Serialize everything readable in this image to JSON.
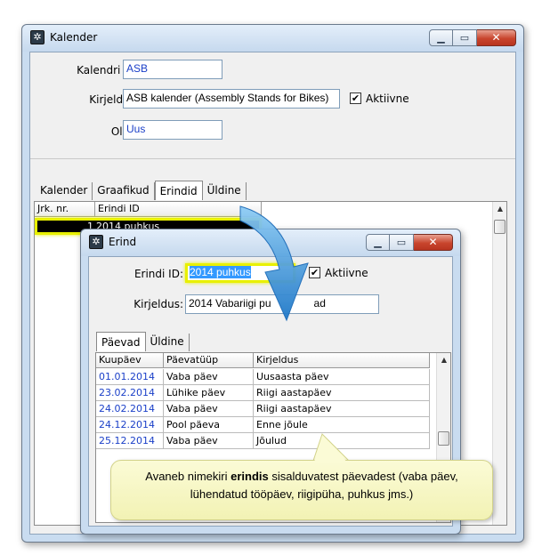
{
  "kalender_window": {
    "title": "Kalender",
    "fields": {
      "id_label": "Kalendri ID:",
      "id_value": "ASB",
      "desc_label": "Kirjeldus:",
      "desc_value": "ASB kalender (Assembly Stands for Bikes)",
      "active_label": "Aktiivne",
      "active_checked": "✔",
      "status_label": "Olek:",
      "status_value": "Uus"
    },
    "tabs": [
      "Kalender",
      "Graafikud",
      "Erindid",
      "Üldine"
    ],
    "table": {
      "headers": [
        "Jrk. nr.",
        "Erindi ID"
      ],
      "rows": [
        {
          "nr": "1",
          "id": "2014 puhkus"
        }
      ]
    }
  },
  "erind_window": {
    "title": "Erind",
    "fields": {
      "id_label": "Erindi ID:",
      "id_value": "2014 puhkus",
      "active_label": "Aktiivne",
      "active_checked": "✔",
      "desc_label": "Kirjeldus:",
      "desc_value": "2014 Vabariigi pu",
      "desc_value_tail": "ad"
    },
    "tabs": [
      "Päevad",
      "Üldine"
    ],
    "table": {
      "headers": [
        "Kuupäev",
        "Päevatüüp",
        "Kirjeldus"
      ],
      "rows": [
        {
          "date": "01.01.2014",
          "type": "Vaba päev",
          "desc": "Uusaasta päev"
        },
        {
          "date": "23.02.2014",
          "type": "Lühike päev",
          "desc": "Riigi aastapäev"
        },
        {
          "date": "24.02.2014",
          "type": "Vaba päev",
          "desc": "Riigi aastapäev"
        },
        {
          "date": "24.12.2014",
          "type": "Pool päeva",
          "desc": "Enne jõule"
        },
        {
          "date": "25.12.2014",
          "type": "Vaba päev",
          "desc": "Jõulud"
        }
      ]
    }
  },
  "callout": {
    "text_before": "Avaneb nimekiri ",
    "text_bold": "erindis",
    "text_after": " sisalduvatest päevadest (vaba päev, lühendatud tööpäev, riigipüha, puhkus jms.)"
  },
  "colors": {
    "highlight": "#e8f000",
    "arrow": "#2f8fd8",
    "link_blue": "#1a3fc8"
  }
}
